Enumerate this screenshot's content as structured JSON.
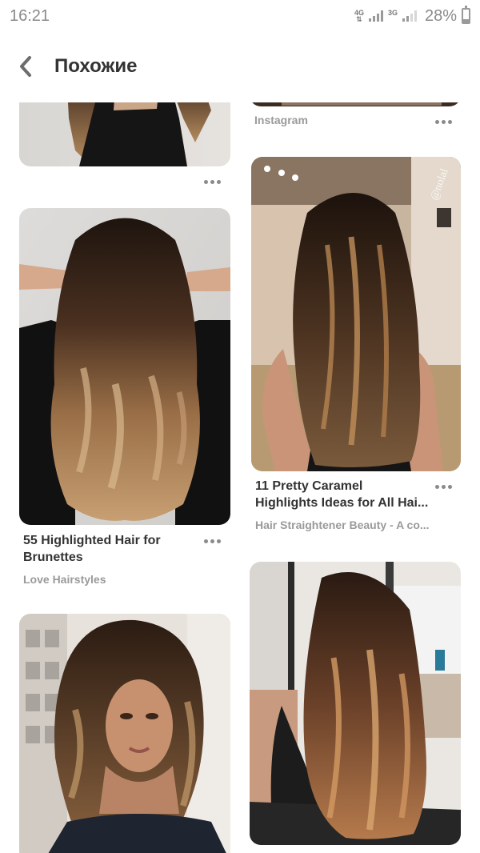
{
  "status_bar": {
    "time": "16:21",
    "net1": "4G",
    "net2": "3G",
    "battery": "28%",
    "battery_level": 0.28
  },
  "header": {
    "title": "Похожие",
    "back_icon": "chevron-left-icon"
  },
  "pins": [
    {
      "id": "left-top",
      "title": "",
      "source": ""
    },
    {
      "id": "right-top",
      "title": "",
      "source": "Instagram"
    },
    {
      "id": "left-1",
      "title": "55 Highlighted Hair for\nBrunettes",
      "source": "Love Hairstyles"
    },
    {
      "id": "right-1",
      "title": "11 Pretty Caramel\nHighlights Ideas for All Hai...",
      "source": "Hair Straightener Beauty - A co..."
    },
    {
      "id": "left-2",
      "title": "",
      "source": ""
    },
    {
      "id": "right-2",
      "title": "",
      "source": ""
    }
  ],
  "colors": {
    "text_primary": "#333333",
    "text_secondary": "#9a9a9a",
    "background": "#ffffff"
  }
}
